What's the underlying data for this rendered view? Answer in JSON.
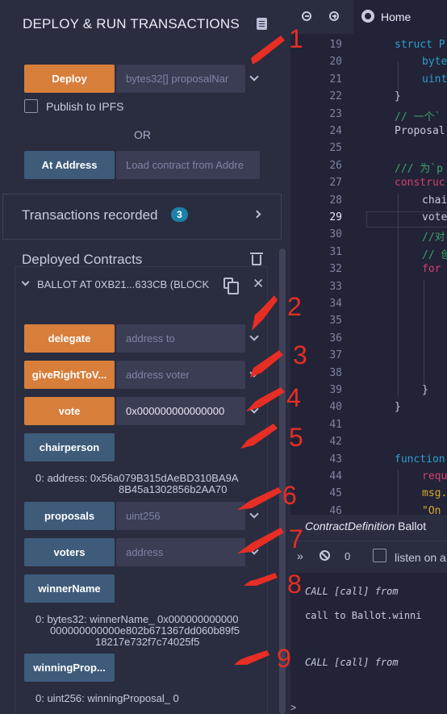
{
  "panel": {
    "title": "DEPLOY & RUN TRANSACTIONS",
    "deploy": {
      "label": "Deploy",
      "placeholder": "bytes32[] proposalNar"
    },
    "publish_ipfs": "Publish to IPFS",
    "or": "OR",
    "at_address": {
      "label": "At Address",
      "placeholder": "Load contract from Addre"
    },
    "transactions": {
      "label": "Transactions recorded",
      "count": "3"
    },
    "deployed_label": "Deployed Contracts",
    "contract": {
      "title": "BALLOT AT 0XB21...633CB (BLOCK",
      "functions": {
        "delegate": {
          "label": "delegate",
          "placeholder": "address to"
        },
        "giveRight": {
          "label": "giveRightToV...",
          "placeholder": "address voter"
        },
        "vote": {
          "label": "vote",
          "value": "0x000000000000000"
        },
        "chairperson": {
          "label": "chairperson",
          "result": "0:  address: 0x56a079B315dAeBD310BA9A8B45a1302856b2AA70",
          "result_l1": "0:  address: 0x56a079B315dAeBD310BA9A",
          "result_l2": "8B45a1302856b2AA70"
        },
        "proposals": {
          "label": "proposals",
          "placeholder": "uint256"
        },
        "voters": {
          "label": "voters",
          "placeholder": "address"
        },
        "winnerName": {
          "label": "winnerName",
          "result_l1": "0:  bytes32: winnerName_ 0x000000000000",
          "result_l2": "000000000000e802b671367dd060b89f5",
          "result_l3": "18217e732f7c74025f5"
        },
        "winningProposal": {
          "label": "winningProp...",
          "result": "0: uint256: winningProposal_ 0"
        }
      }
    }
  },
  "markers": [
    "1",
    "2",
    "3",
    "4",
    "5",
    "6",
    "7",
    "8",
    "9"
  ],
  "editor": {
    "home_tab": "Home",
    "line_numbers": [
      "19",
      "20",
      "21",
      "22",
      "23",
      "24",
      "25",
      "26",
      "27",
      "28",
      "29",
      "30",
      "31",
      "32",
      "33",
      "34",
      "35",
      "36",
      "37",
      "38",
      "39",
      "40",
      "41",
      "42",
      "43",
      "44",
      "45",
      "46"
    ],
    "active_line": "29",
    "code": [
      {
        "ln": "19",
        "text": "struct P",
        "color": "#2e9fcf",
        "indent": 0
      },
      {
        "ln": "20",
        "text": "byte",
        "color": "#2e9fcf",
        "indent": 1
      },
      {
        "ln": "21",
        "text": "uint",
        "color": "#2e9fcf",
        "indent": 1
      },
      {
        "ln": "22",
        "text": "}",
        "color": "#c7cbe0",
        "indent": 0
      },
      {
        "ln": "23",
        "text": "// 一个`",
        "color": "#3aa36b",
        "indent": 0
      },
      {
        "ln": "24",
        "text": "Proposal",
        "color": "#c7cbe0",
        "indent": 0
      },
      {
        "ln": "26",
        "text": "/// 为`p",
        "color": "#3aa36b",
        "indent": 0
      },
      {
        "ln": "27",
        "text": "construc",
        "color": "#d5406f",
        "indent": 0
      },
      {
        "ln": "28",
        "text": "chai",
        "color": "#c7cbe0",
        "indent": 1
      },
      {
        "ln": "29",
        "text": "vote",
        "color": "#c7cbe0",
        "indent": 1
      },
      {
        "ln": "30",
        "text": "//对",
        "color": "#3aa36b",
        "indent": 1
      },
      {
        "ln": "31",
        "text": "// 创",
        "color": "#3aa36b",
        "indent": 1
      },
      {
        "ln": "32",
        "text": "for",
        "color": "#d5406f",
        "indent": 1
      },
      {
        "ln": "39",
        "text": "}",
        "color": "#c7cbe0",
        "indent": 1
      },
      {
        "ln": "40",
        "text": "}",
        "color": "#c7cbe0",
        "indent": 0
      },
      {
        "ln": "43",
        "text": "function",
        "color": "#2e9fcf",
        "indent": 0
      },
      {
        "ln": "44",
        "text": "requ",
        "color": "#d5406f",
        "indent": 1
      },
      {
        "ln": "45",
        "text": "msg.",
        "color": "#d5aa2d",
        "indent": 1
      },
      {
        "ln": "46",
        "text": "\"On",
        "color": "#d5aa2d",
        "indent": 1
      }
    ]
  },
  "terminal": {
    "title_italic": "ContractDefinition",
    "title_name": "Ballot",
    "pending": "0",
    "listen_label": "listen on a",
    "call1": "CALL   [call] from",
    "call1_detail": "call to Ballot.winni",
    "call2": "CALL   [call] from",
    "more": ">"
  }
}
